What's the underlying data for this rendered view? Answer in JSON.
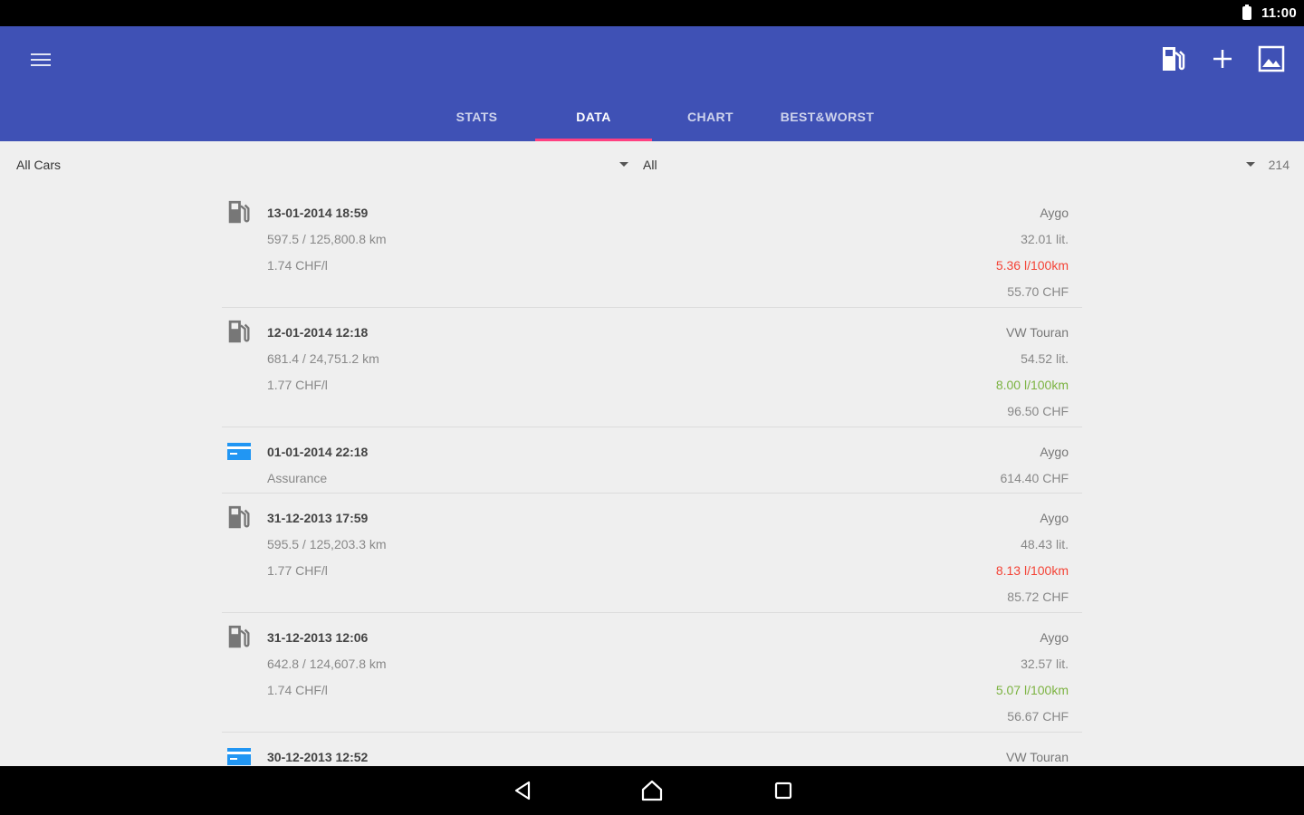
{
  "status": {
    "time": "11:00"
  },
  "tabs": [
    "STATS",
    "DATA",
    "CHART",
    "BEST&WORST"
  ],
  "filters": {
    "car": "All Cars",
    "type": "All",
    "count": "214"
  },
  "entries": [
    {
      "kind": "fuel",
      "date": "13-01-2014 18:59",
      "distance": "597.5 / 125,800.8 km",
      "price": "1.74 CHF/l",
      "car": "Aygo",
      "volume": "32.01 lit.",
      "consumption": "5.36 l/100km",
      "consumption_status": "bad",
      "cost": "55.70 CHF"
    },
    {
      "kind": "fuel",
      "date": "12-01-2014 12:18",
      "distance": "681.4 / 24,751.2 km",
      "price": "1.77 CHF/l",
      "car": "VW Touran",
      "volume": "54.52 lit.",
      "consumption": "8.00 l/100km",
      "consumption_status": "good",
      "cost": "96.50 CHF"
    },
    {
      "kind": "cost",
      "date": "01-01-2014 22:18",
      "note": "Assurance",
      "car": "Aygo",
      "cost": "614.40 CHF"
    },
    {
      "kind": "fuel",
      "date": "31-12-2013 17:59",
      "distance": "595.5 / 125,203.3 km",
      "price": "1.77 CHF/l",
      "car": "Aygo",
      "volume": "48.43 lit.",
      "consumption": "8.13 l/100km",
      "consumption_status": "bad",
      "cost": "85.72 CHF"
    },
    {
      "kind": "fuel",
      "date": "31-12-2013 12:06",
      "distance": "642.8 / 124,607.8 km",
      "price": "1.74 CHF/l",
      "car": "Aygo",
      "volume": "32.57 lit.",
      "consumption": "5.07 l/100km",
      "consumption_status": "good",
      "cost": "56.67 CHF"
    },
    {
      "kind": "cost",
      "date": "30-12-2013 12:52",
      "note": "",
      "car": "VW Touran",
      "cost": ""
    }
  ],
  "colors": {
    "primary": "#3f51b5",
    "accent": "#ff4081",
    "bad": "#f44336",
    "good": "#7cb342",
    "cost_icon": "#2196f3"
  },
  "icons": {
    "menu": "menu-icon",
    "fuel_action": "fuel-pump-icon",
    "add": "plus-icon",
    "image": "image-icon",
    "fuel_entry": "fuel-pump-icon",
    "cost_entry": "credit-card-icon"
  }
}
